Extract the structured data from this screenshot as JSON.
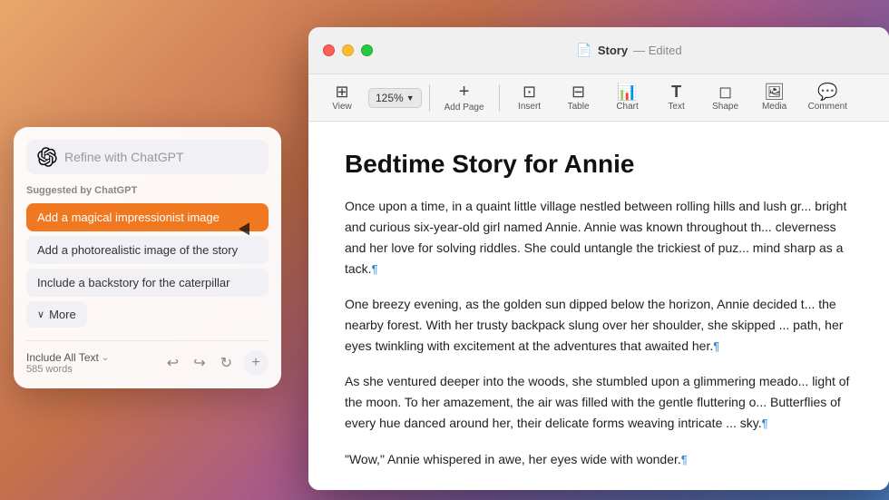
{
  "desktop": {
    "background": "macOS Ventura gradient"
  },
  "window": {
    "title": "Story",
    "edited": "Edited",
    "doc_icon": "📄"
  },
  "toolbar": {
    "zoom_label": "125%",
    "items": [
      {
        "label": "View",
        "icon": "⊞"
      },
      {
        "label": "Zoom",
        "icon": "125% ▾"
      },
      {
        "label": "Add Page",
        "icon": "+"
      },
      {
        "label": "Insert",
        "icon": "⊡"
      },
      {
        "label": "Table",
        "icon": "⊟"
      },
      {
        "label": "Chart",
        "icon": "↗"
      },
      {
        "label": "Text",
        "icon": "T"
      },
      {
        "label": "Shape",
        "icon": "◻"
      },
      {
        "label": "Media",
        "icon": "🖼"
      },
      {
        "label": "Comment",
        "icon": "💬"
      }
    ]
  },
  "document": {
    "title": "Bedtime Story for Annie",
    "paragraphs": [
      "Once upon a time, in a quaint little village nestled between rolling hills and lush gr... bright and curious six-year-old girl named Annie. Annie was known throughout th... cleverness and her love for solving riddles. She could untangle the trickiest of puz... mind sharp as a tack.¶",
      "One breezy evening, as the golden sun dipped below the horizon, Annie decided t... the nearby forest. With her trusty backpack slung over her shoulder, she skipped ... path, her eyes twinkling with excitement at the adventures that awaited her.¶",
      "As she ventured deeper into the woods, she stumbled upon a glimmering meado... light of the moon. To her amazement, the air was filled with the gentle fluttering o... Butterflies of every hue danced around her, their delicate forms weaving intricate ... sky.¶",
      "\"Wow,\" Annie whispered in awe, her eyes wide with wonder.¶",
      "¶"
    ]
  },
  "chatgpt_panel": {
    "input_placeholder": "Refine with ChatGPT",
    "section_label": "Suggested by ChatGPT",
    "suggestions": [
      {
        "label": "Add a magical impressionist image",
        "active": true
      },
      {
        "label": "Add a photorealistic image of the story",
        "active": false
      },
      {
        "label": "Include a backstory for the caterpillar",
        "active": false
      }
    ],
    "more_button": "More",
    "footer": {
      "include_label": "Include All Text",
      "words_count": "585 words"
    },
    "actions": {
      "undo": "↩",
      "redo": "↪",
      "refresh": "↻",
      "add": "+"
    }
  }
}
